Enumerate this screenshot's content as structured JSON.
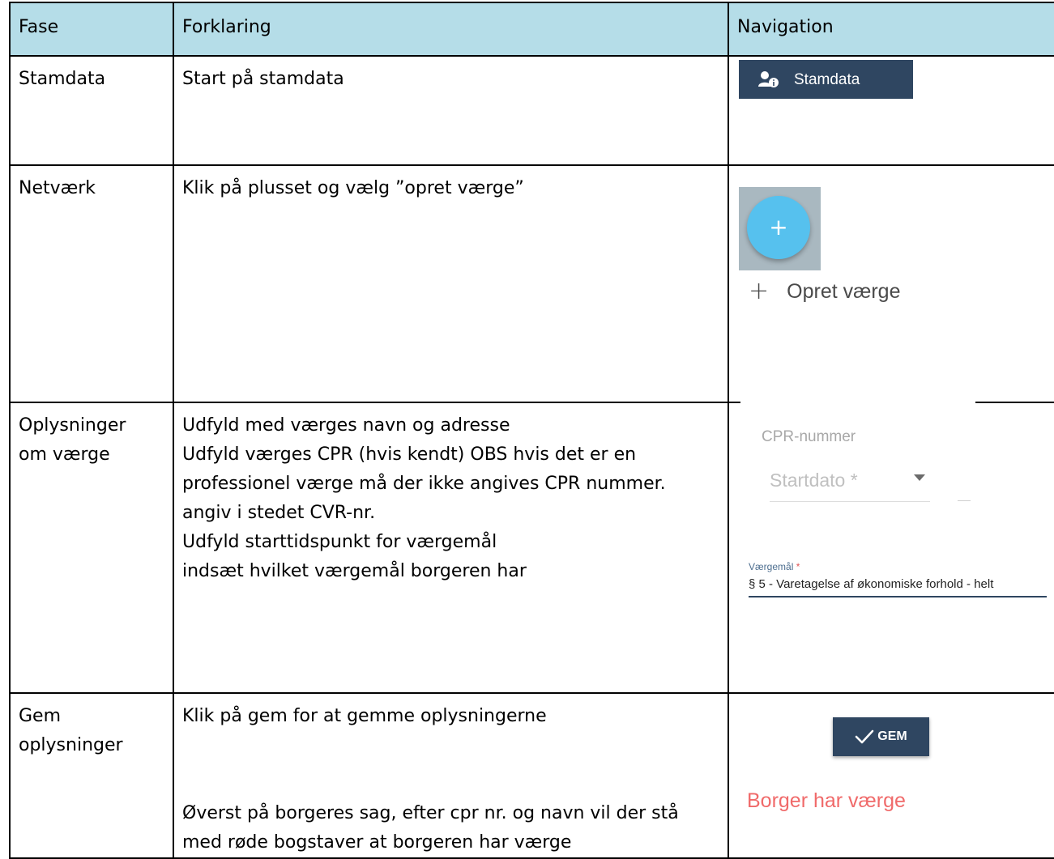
{
  "table": {
    "headers": {
      "fase": "Fase",
      "forklaring": "Forklaring",
      "navigation": "Navigation"
    },
    "rows": [
      {
        "fase": "Stamdata",
        "forklaring": [
          "Start på stamdata"
        ]
      },
      {
        "fase": "Netværk",
        "forklaring": [
          "Klik på plusset og vælg ”opret værge”"
        ]
      },
      {
        "fase": [
          "Oplysninger",
          "om værge"
        ],
        "forklaring": [
          "Udfyld med værges navn og adresse",
          "Udfyld værges CPR (hvis kendt) OBS hvis det er en",
          "professionel værge må der ikke angives CPR nummer.",
          "angiv i stedet CVR-nr.",
          "Udfyld starttidspunkt for værgemål",
          "indsæt hvilket værgemål borgeren har"
        ]
      },
      {
        "fase": [
          "Gem",
          "oplysninger"
        ],
        "forklaring": [
          "Klik på gem for at gemme oplysningerne",
          "Øverst på borgeres sag, efter cpr nr. og navn vil der stå",
          "med røde bogstaver at borgeren har værge"
        ]
      }
    ]
  },
  "navigation": {
    "stamdata_button": {
      "label": "Stamdata",
      "icon": "person-info-icon"
    },
    "fab": {
      "label": "+",
      "icon": "plus-icon",
      "color": "#56c1ee"
    },
    "opret_vaerge": {
      "label": "Opret værge",
      "icon": "plus-icon"
    },
    "form": {
      "cpr_label": "CPR-nummer",
      "startdato_placeholder": "Startdato *",
      "vaergemaal_label": "Værgemål",
      "vaergemaal_required": "*",
      "vaergemaal_value": "§ 5 - Varetagelse af økonomiske forhold - helt"
    },
    "gem_button": {
      "label": "GEM",
      "icon": "check-icon"
    },
    "status_text": "Borger har værge"
  },
  "colors": {
    "header_background": "#b5dde8",
    "button_background": "#2f4661",
    "status_text": "#f06a6a"
  }
}
